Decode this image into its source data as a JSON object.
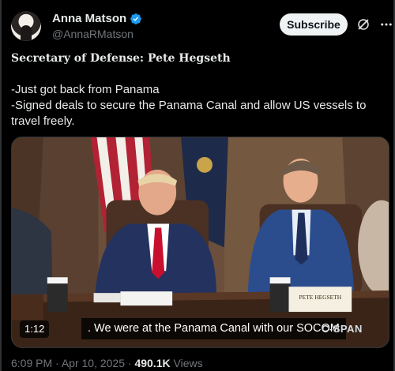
{
  "author": {
    "name": "Anna Matson",
    "handle": "@AnnaRMatson",
    "verified": true
  },
  "actions": {
    "subscribe_label": "Subscribe",
    "grok_icon": "grok-icon",
    "more_icon": "more-icon"
  },
  "tweet": {
    "title": "Secretary of Defense: Pete Hegseth",
    "lines": [
      "-Just got back from Panama",
      "-Signed deals to secure the Panama Canal and allow US vessels to travel freely."
    ]
  },
  "video": {
    "timecode": "1:12",
    "caption": ". We were at the Panama Canal with our SOCOM",
    "network_logo": "C-SPAN",
    "nameplate": "PETE HEGSETH"
  },
  "footer": {
    "time": "6:09 PM",
    "date": "Apr 10, 2025",
    "views_count": "490.1K",
    "views_label": "Views"
  },
  "colors": {
    "background": "#000000",
    "text": "#e7e9ea",
    "muted": "#71767b",
    "verified": "#1d9bf0",
    "button": "#eff3f4"
  }
}
